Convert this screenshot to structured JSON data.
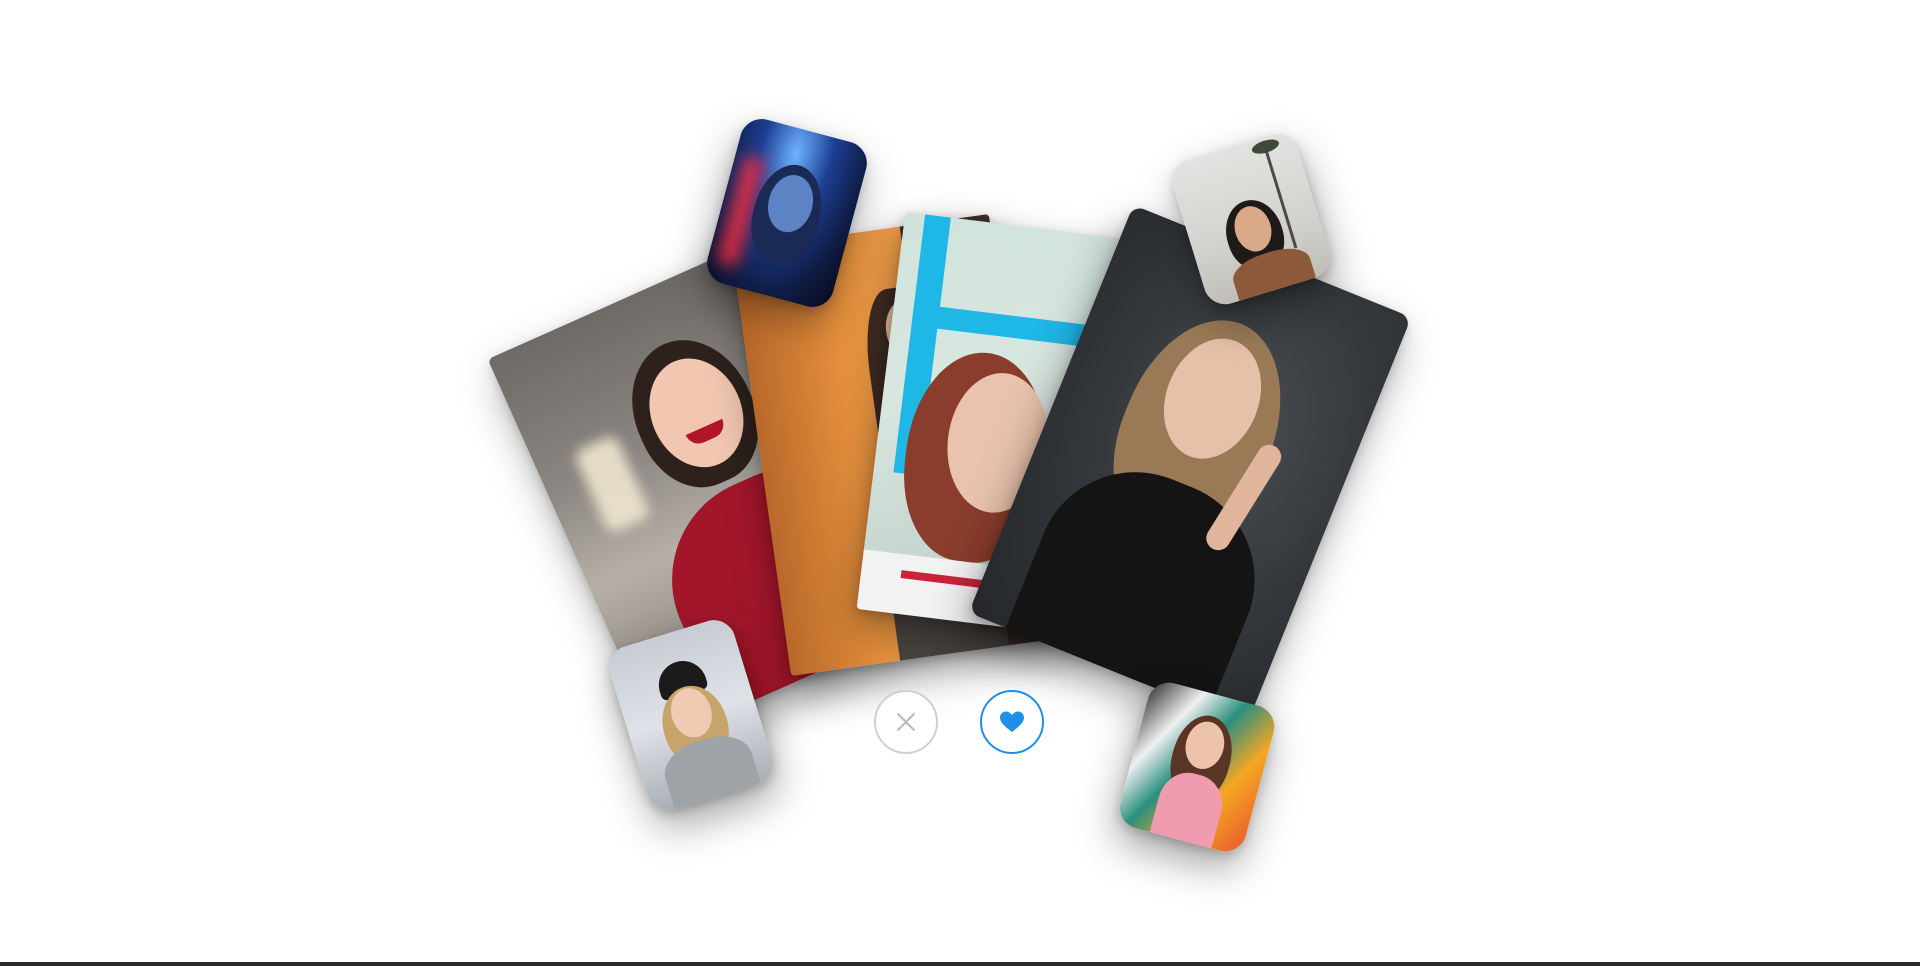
{
  "app": {
    "accent_color": "#1f8fe8",
    "neutral_color": "#cfcfcf"
  },
  "cards": [
    {
      "id": "card-1",
      "description_icon": "profile-photo",
      "dominant_color": "#b01f2c"
    },
    {
      "id": "card-2",
      "description_icon": "profile-photo",
      "dominant_color": "#e48f3c"
    },
    {
      "id": "card-3",
      "description_icon": "profile-photo",
      "dominant_color": "#1fb7e6"
    },
    {
      "id": "card-4",
      "description_icon": "profile-photo",
      "dominant_color": "#33363a"
    }
  ],
  "thumbnails": [
    {
      "id": "thumb-neon",
      "dominant_color": "#1c3f94"
    },
    {
      "id": "thumb-palms",
      "dominant_color": "#d2d2cf"
    },
    {
      "id": "thumb-winter",
      "dominant_color": "#c7ccd4"
    },
    {
      "id": "thumb-graffiti",
      "dominant_color": "#f5a623"
    }
  ],
  "actions": {
    "dislike": {
      "icon": "close-icon",
      "color": "#cfcfcf"
    },
    "like": {
      "icon": "heart-icon",
      "color": "#1f8fe8"
    }
  }
}
